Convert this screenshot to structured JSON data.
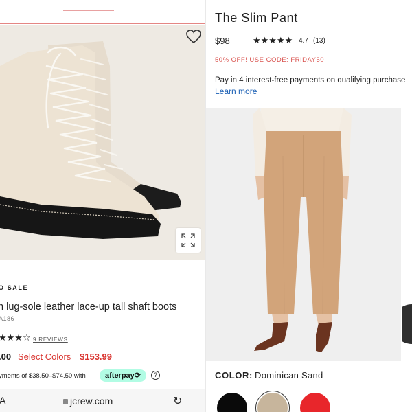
{
  "left": {
    "sale_label": "O SALE",
    "product_title": "n lug-sole leather lace-up tall shaft boots",
    "sku": "A186",
    "stars": "★★★☆",
    "reviews_link": "9 REVIEWS",
    "price_original": ".00",
    "select_colors": "Select Colors",
    "sale_price": "$153.99",
    "installments": "yments of $38.50–$74.50 with",
    "afterpay": "afterpay⟳",
    "info": "?",
    "aa": "A",
    "url": "jcrew.com",
    "reload": "↻"
  },
  "right": {
    "title": "The Slim Pant",
    "price": "$98",
    "stars": "★★★★★",
    "rating": "4.7",
    "review_count": "(13)",
    "promo": "50% OFF! USE CODE: FRIDAY50",
    "pay_text": "Pay in 4 interest-free payments on qualifying purchase",
    "learn_more": "Learn more",
    "color_label": "COLOR:",
    "color_value": "Dominican Sand",
    "swatches": [
      {
        "name": "Black",
        "color": "#0a0a0a"
      },
      {
        "name": "Dominican Sand",
        "color": "#c7b59c"
      },
      {
        "name": "Red",
        "color": "#e8262b"
      }
    ]
  },
  "colors": {
    "sale_red": "#d9332e",
    "link_blue": "#1a5fb4",
    "afterpay_mint": "#b2fce4"
  }
}
